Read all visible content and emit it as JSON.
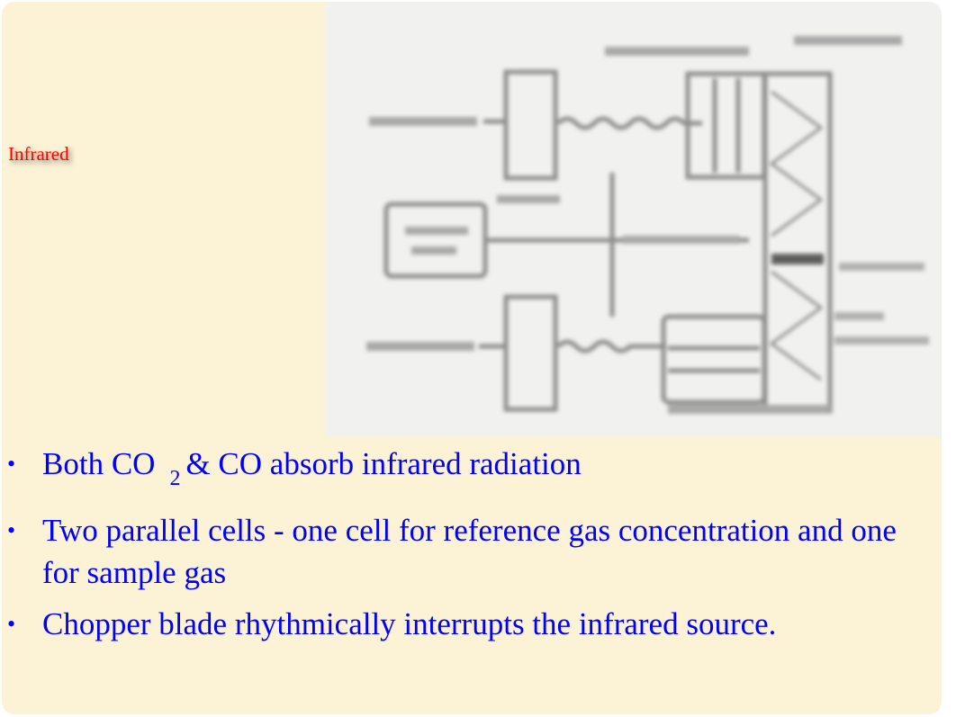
{
  "slide": {
    "title": "Infrared",
    "bullets": [
      {
        "parts": [
          "Both CO",
          "2",
          "& CO absorb infrared radiation"
        ]
      },
      {
        "text": "Two parallel cells - one cell for reference gas concentration and one for sample gas"
      },
      {
        "text": "Chopper blade rhythmically interrupts the infrared source."
      }
    ],
    "bullet_glyph": "•",
    "figure": {
      "description": "Blurred schematic of an infrared gas analyzer: two infrared sources, chopper motor and blade, sample and reference gas cells, detector",
      "labels_legible": false
    },
    "colors": {
      "background": "#fcf3d6",
      "title": "#ff0000",
      "body_text": "#0000ff",
      "figure_bg": "#f1f1ef"
    }
  }
}
